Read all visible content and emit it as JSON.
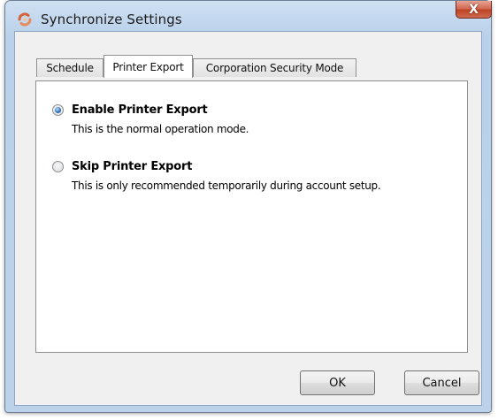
{
  "window": {
    "title": "Synchronize Settings",
    "close_label": "X"
  },
  "tabs": [
    {
      "label": "Schedule",
      "active": false
    },
    {
      "label": "Printer Export",
      "active": true
    },
    {
      "label": "Corporation Security Mode",
      "active": false
    }
  ],
  "options": [
    {
      "label": "Enable Printer Export",
      "description": "This is the normal operation mode.",
      "selected": true
    },
    {
      "label": "Skip Printer Export",
      "description": "This is only recommended temporarily during account setup.",
      "selected": false
    }
  ],
  "buttons": {
    "ok_label": "OK",
    "cancel_label": "Cancel"
  },
  "icons": {
    "app": "sync-app-icon",
    "close": "close-icon"
  },
  "colors": {
    "titlebar": "#b9d1ea",
    "close_button": "#c04426",
    "radio_selected": "#2a6fb5"
  }
}
